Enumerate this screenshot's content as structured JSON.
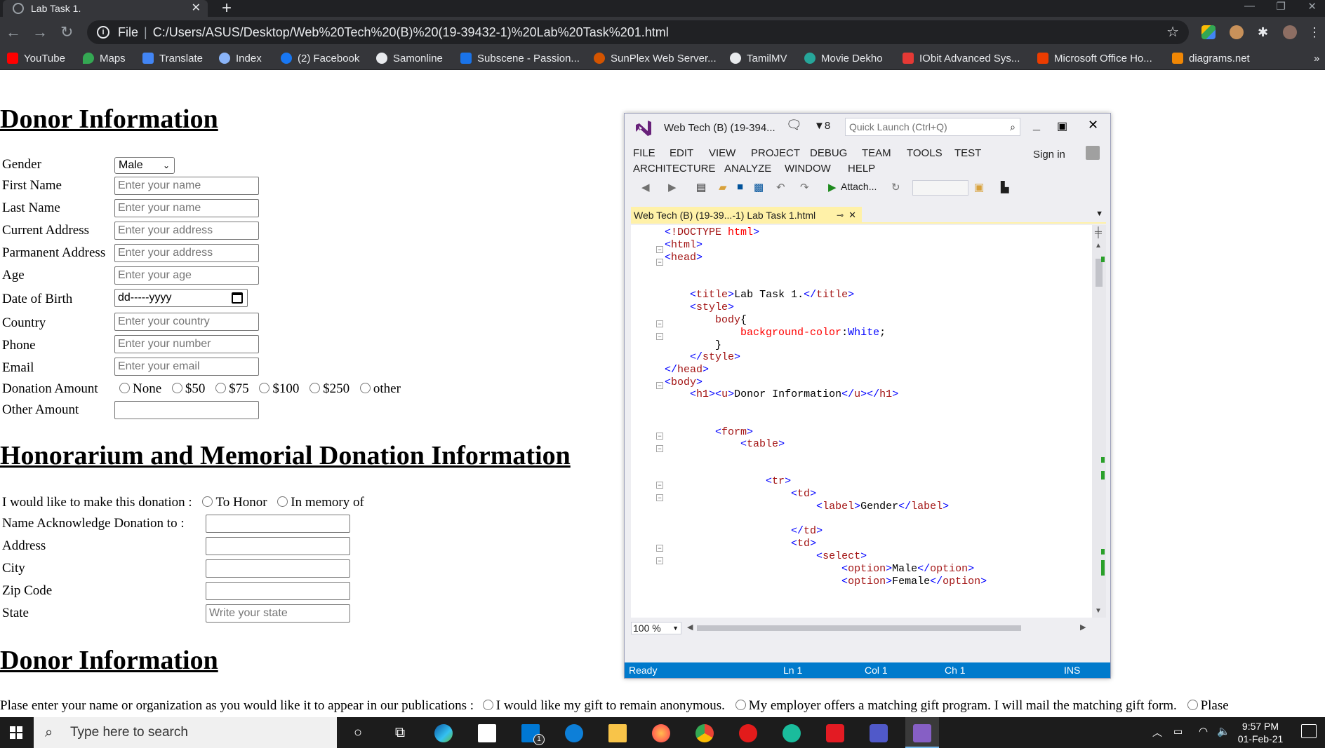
{
  "browser": {
    "tab_title": "Lab Task 1.",
    "address_scheme": "File",
    "address_url": "C:/Users/ASUS/Desktop/Web%20Tech%20(B)%20(19-39432-1)%20Lab%20Task%201.html",
    "bookmarks": [
      {
        "label": "YouTube",
        "color": "#ff0000"
      },
      {
        "label": "Maps",
        "color": "#34a853"
      },
      {
        "label": "Translate",
        "color": "#4285f4"
      },
      {
        "label": "Index",
        "color": "#8ab4f8"
      },
      {
        "label": "(2) Facebook",
        "color": "#1877f2"
      },
      {
        "label": "Samonline",
        "color": "#e8eaed"
      },
      {
        "label": "Subscene - Passion...",
        "color": "#1a73e8"
      },
      {
        "label": "SunPlex Web Server...",
        "color": "#d35400"
      },
      {
        "label": "TamilMV",
        "color": "#e8eaed"
      },
      {
        "label": "Movie Dekho",
        "color": "#26a69a"
      },
      {
        "label": "IObit Advanced Sys...",
        "color": "#e53935"
      },
      {
        "label": "Microsoft Office Ho...",
        "color": "#eb3c00"
      },
      {
        "label": "diagrams.net",
        "color": "#f08705"
      }
    ],
    "more_bookmarks": "»"
  },
  "page": {
    "section1_title": "Donor Information",
    "gender_label": "Gender",
    "gender_value": "Male",
    "fields": [
      {
        "label": "First Name",
        "placeholder": "Enter your name"
      },
      {
        "label": "Last Name",
        "placeholder": "Enter your name"
      },
      {
        "label": "Current Address",
        "placeholder": "Enter your address"
      },
      {
        "label": "Parmanent Address",
        "placeholder": "Enter your address"
      },
      {
        "label": "Age",
        "placeholder": "Enter your age"
      },
      {
        "label": "Date of Birth",
        "placeholder": "dd-----yyyy"
      },
      {
        "label": "Country",
        "placeholder": "Enter your country"
      },
      {
        "label": "Phone",
        "placeholder": "Enter your number"
      },
      {
        "label": "Email",
        "placeholder": "Enter your email"
      }
    ],
    "donation_label": "Donation Amount",
    "donation_options": [
      "None",
      "$50",
      "$75",
      "$100",
      "$250",
      "other"
    ],
    "other_amount_label": "Other Amount",
    "section2_title": "Honorarium and Memorial Donation Information",
    "donation_type_label": "I would like to make this donation :",
    "donation_type_options": [
      "To Honor",
      "In memory of"
    ],
    "honor_fields": [
      {
        "label": "Name Acknowledge Donation to :",
        "placeholder": ""
      },
      {
        "label": "Address",
        "placeholder": ""
      },
      {
        "label": "City",
        "placeholder": ""
      },
      {
        "label": "Zip Code",
        "placeholder": ""
      },
      {
        "label": "State",
        "placeholder": "Write your state"
      }
    ],
    "section3_title": "Donor Information",
    "publication_label": "Plase enter your name or organization as you would like it to appear in our publications :",
    "publication_options": [
      "I would like my gift to remain anonymous.",
      "My employer offers a matching gift program. I will mail the matching gift form.",
      "Plase"
    ]
  },
  "vs": {
    "title": "Web Tech (B) (19-394...",
    "notif_count": "8",
    "quick_launch": "Quick Launch (Ctrl+Q)",
    "menu": [
      "FILE",
      "EDIT",
      "VIEW",
      "PROJECT",
      "DEBUG",
      "TEAM",
      "TOOLS",
      "TEST",
      "ARCHITECTURE",
      "ANALYZE",
      "WINDOW",
      "HELP"
    ],
    "sign_in": "Sign in",
    "attach": "Attach...",
    "doc_tab": "Web Tech (B) (19-39...-1) Lab Task 1.html",
    "zoom": "100 %",
    "status": {
      "ready": "Ready",
      "ln": "Ln 1",
      "col": "Col 1",
      "ch": "Ch 1",
      "ins": "INS"
    }
  },
  "taskbar": {
    "search_placeholder": "Type here to search",
    "time": "9:57 PM",
    "date": "01-Feb-21",
    "mail_badge": "1"
  }
}
